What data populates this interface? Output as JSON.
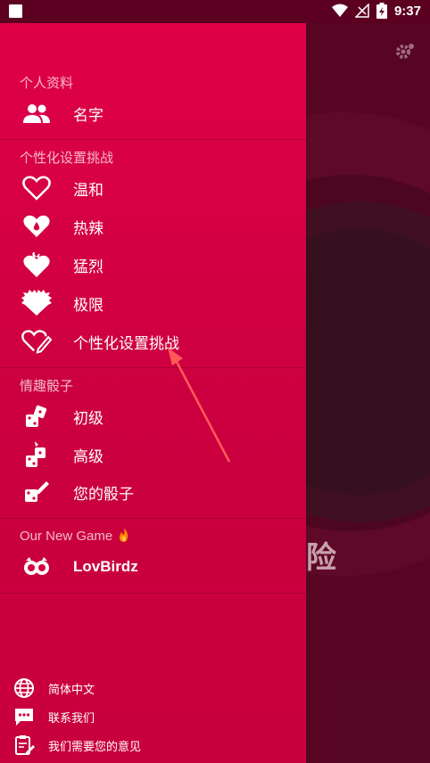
{
  "status_bar": {
    "time": "9:37"
  },
  "background_app": {
    "partial_text": "险"
  },
  "drawer": {
    "profile_section": {
      "title": "个人资料",
      "items": [
        {
          "label": "名字",
          "icon": "people-icon"
        }
      ]
    },
    "challenge_section": {
      "title": "个性化设置挑战",
      "items": [
        {
          "label": "温和",
          "icon": "heart-outline-icon"
        },
        {
          "label": "热辣",
          "icon": "heart-drop-icon"
        },
        {
          "label": "猛烈",
          "icon": "heart-flame-icon"
        },
        {
          "label": "极限",
          "icon": "heart-spiky-icon"
        },
        {
          "label": "个性化设置挑战",
          "icon": "heart-pencil-icon"
        }
      ]
    },
    "dice_section": {
      "title": "情趣骰子",
      "items": [
        {
          "label": "初级",
          "icon": "dice-icon"
        },
        {
          "label": "高级",
          "icon": "dice-advanced-icon"
        },
        {
          "label": "您的骰子",
          "icon": "dice-pencil-icon"
        }
      ]
    },
    "game_section": {
      "title": "Our New Game",
      "items": [
        {
          "label": "LovBirdz",
          "icon": "lovbirdz-icon"
        }
      ]
    },
    "footer": [
      {
        "label": "简体中文",
        "icon": "globe-icon"
      },
      {
        "label": "联系我们",
        "icon": "chat-icon"
      },
      {
        "label": "我们需要您的意见",
        "icon": "feedback-icon"
      }
    ]
  },
  "colors": {
    "drawer_top": "#e0004a",
    "drawer_bottom": "#c8003c",
    "status_bar": "#5c0022",
    "arrow": "#ff5a5a"
  }
}
